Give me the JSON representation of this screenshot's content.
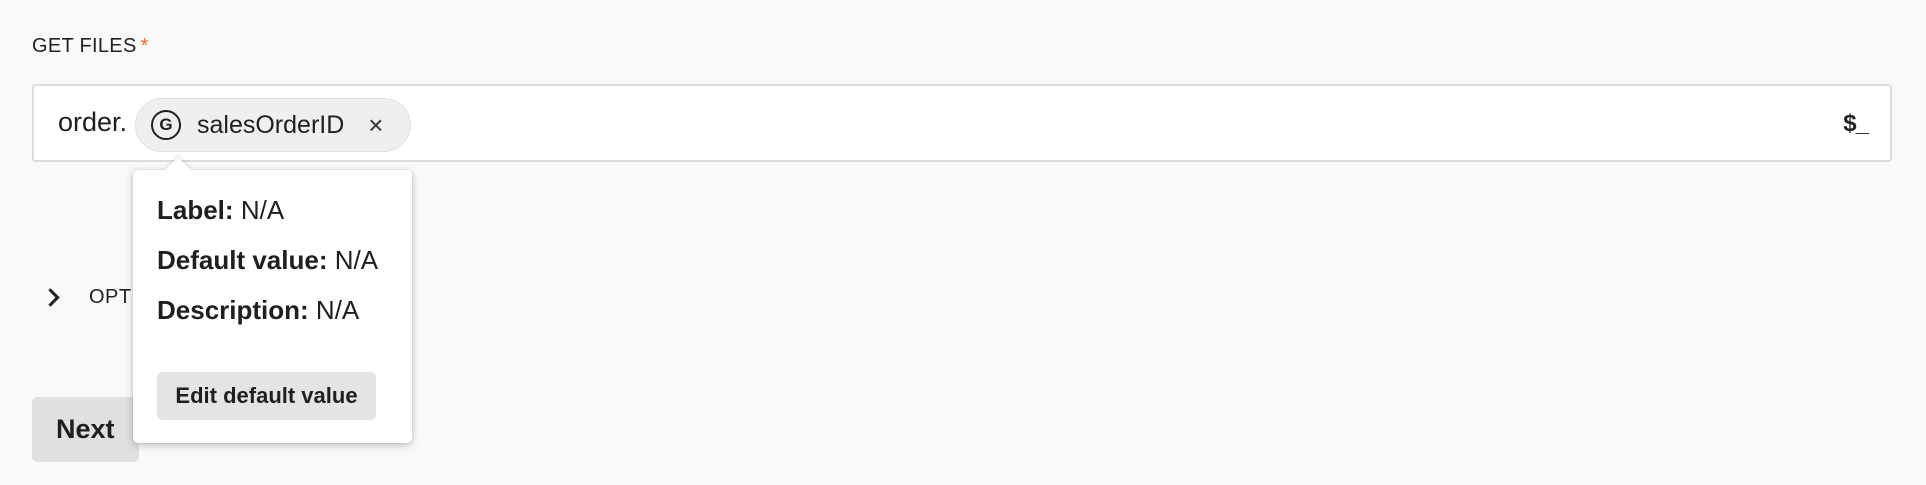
{
  "field": {
    "label": "GET FILES",
    "required_marker": "*",
    "prefix": "order.",
    "chip": {
      "icon_letter": "G",
      "label": "salesOrderID",
      "close_glyph": "×"
    },
    "variable_icon": "$_",
    "icons": {
      "chip": "global-variable-icon",
      "close": "close-icon",
      "variable": "variable-insert-icon"
    }
  },
  "options": {
    "label": "OPTI",
    "icon": "chevron-right-icon"
  },
  "next_button": {
    "label": "Next"
  },
  "popover": {
    "label_key": "Label:",
    "label_value": "N/A",
    "default_key": "Default value:",
    "default_value": "N/A",
    "description_key": "Description:",
    "description_value": "N/A",
    "edit_button": "Edit default value"
  },
  "colors": {
    "required": "#f26b21",
    "background": "#f9f9f9",
    "button": "#e0e0e0"
  }
}
